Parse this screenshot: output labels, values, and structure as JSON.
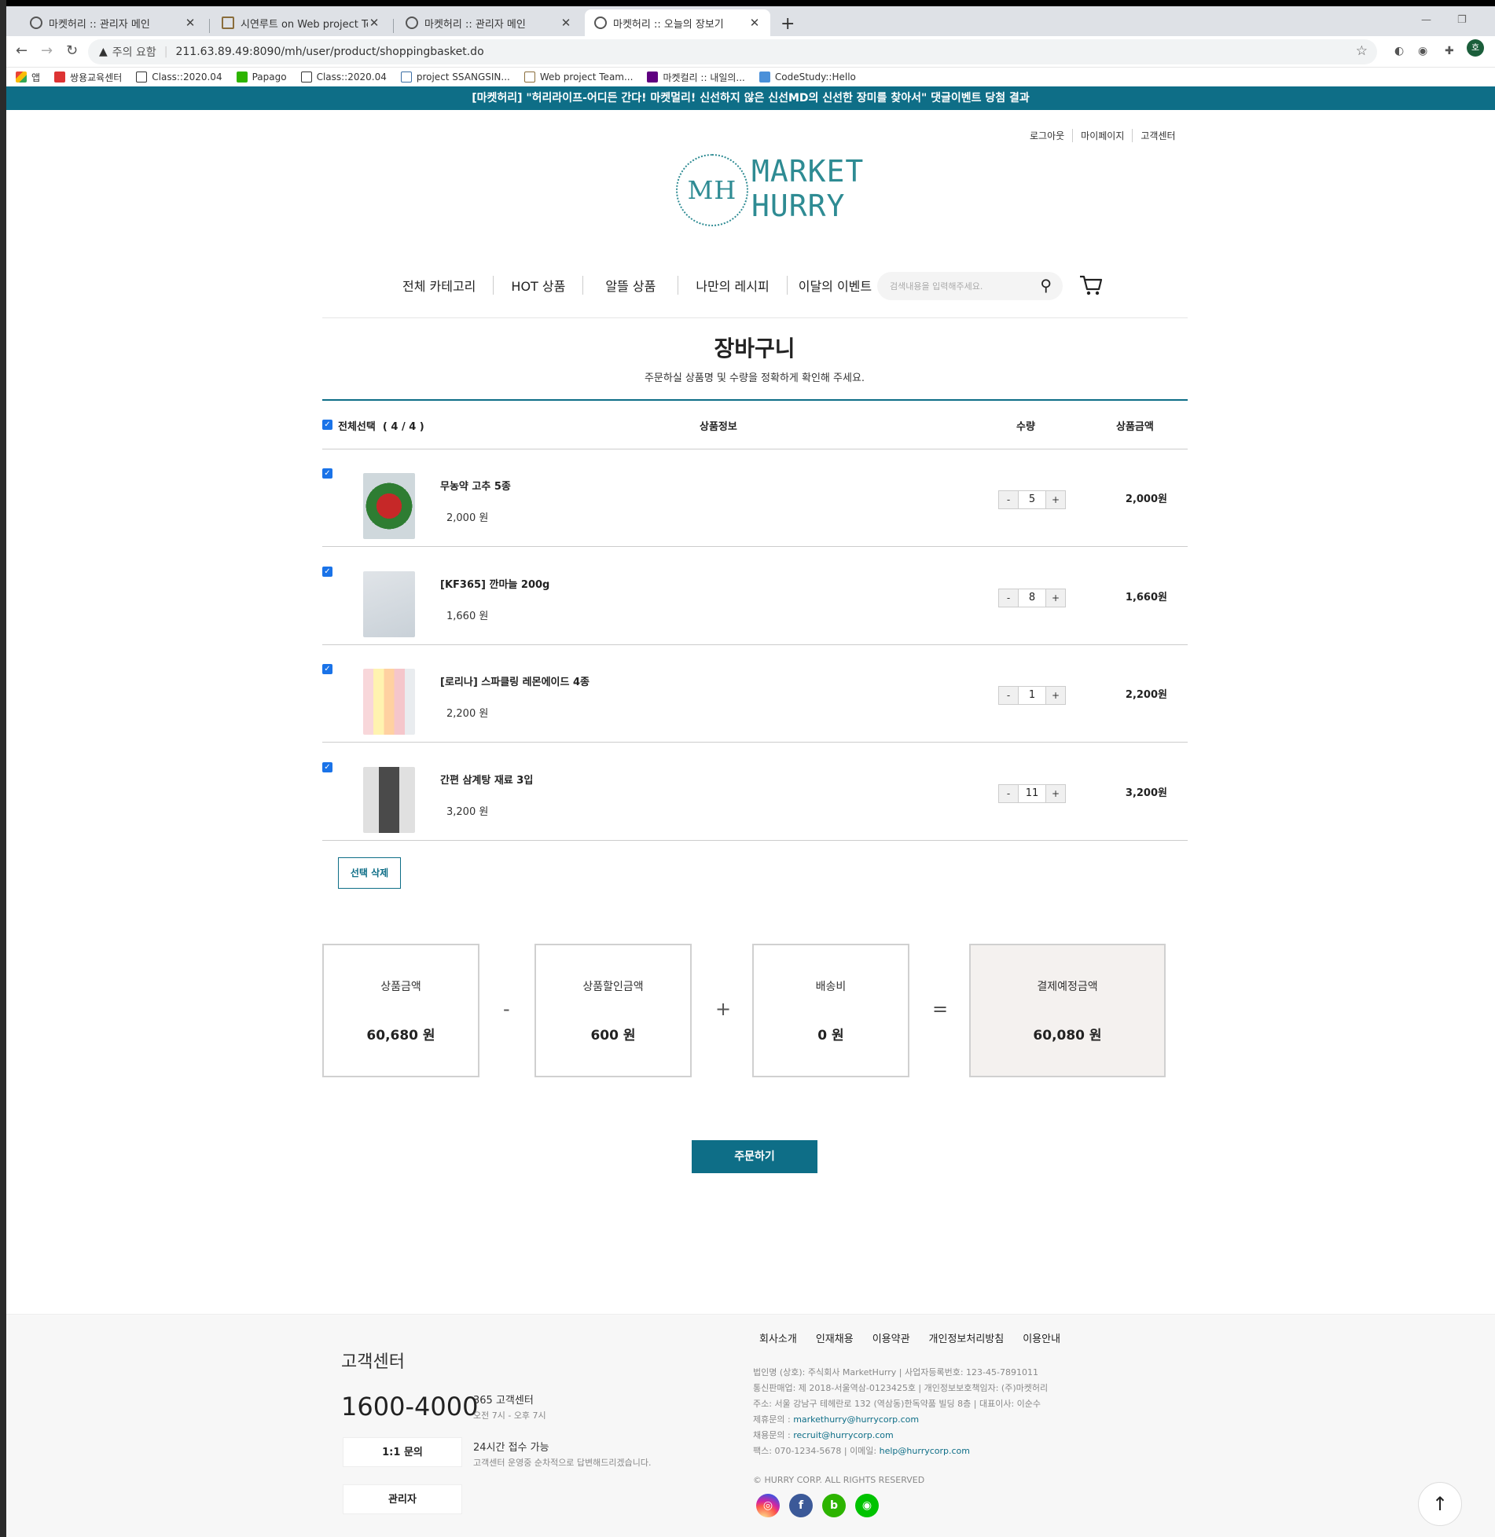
{
  "browser": {
    "tabs": [
      {
        "title": "마켓허리 :: 관리자 메인",
        "active": false
      },
      {
        "title": "시연루트 on Web project Team",
        "active": false
      },
      {
        "title": "마켓허리 :: 관리자 메인",
        "active": false
      },
      {
        "title": "마켓허리 :: 오늘의 장보기",
        "active": true
      }
    ],
    "new_tab": "+",
    "security_label": "주의 요함",
    "url": "211.63.89.49:8090/mh/user/product/shoppingbasket.do",
    "profile_initial": "호",
    "bookmarks": [
      "앱",
      "쌍용교육센터",
      "Class::2020.04",
      "Papago",
      "Class::2020.04",
      "project SSANGSIN...",
      "Web project Team...",
      "마켓컬리 :: 내일의...",
      "CodeStudy::Hello"
    ]
  },
  "banner": "[마켓허리] \"허리라이프-어디든 간다! 마켓멀리! 신선하지 않은 신선MD의 신선한 장미를 찾아서\" 댓글이벤트 당첨 결과",
  "header": {
    "links": [
      "로그아웃",
      "마이페이지",
      "고객센터"
    ],
    "logo": {
      "mark": "MH",
      "line1": "MARKET",
      "line2": "HURRY"
    },
    "menu": [
      "전체 카테고리",
      "HOT 상품",
      "알뜰 상품",
      "나만의 레시피",
      "이달의 이벤트"
    ],
    "search_placeholder": "검색내용을 입력해주세요."
  },
  "page": {
    "title": "장바구니",
    "subtitle": "주문하실 상품명 및 수량을 정확하게 확인해 주세요."
  },
  "cart": {
    "select_all_label": "전체선택",
    "select_count": "( 4 / 4 )",
    "headers": {
      "info": "상품정보",
      "qty": "수량",
      "price": "상품금액"
    },
    "items": [
      {
        "name": "무농약 고추 5종",
        "price": "2,000 원",
        "qty": "5",
        "total": "2,000원"
      },
      {
        "name": "[KF365] 깐마늘 200g",
        "price": "1,660 원",
        "qty": "8",
        "total": "1,660원"
      },
      {
        "name": "[로리나] 스파클링 레몬에이드 4종",
        "price": "2,200 원",
        "qty": "1",
        "total": "2,200원"
      },
      {
        "name": "간편 삼계탕 재료 3입",
        "price": "3,200 원",
        "qty": "11",
        "total": "3,200원"
      }
    ],
    "minus": "-",
    "plus": "+",
    "delete_selected": "선택 삭제"
  },
  "summary": {
    "product_amount": {
      "label": "상품금액",
      "value": "60,680 원"
    },
    "discount": {
      "label": "상품할인금액",
      "value": "600 원"
    },
    "shipping": {
      "label": "배송비",
      "value": "0 원"
    },
    "final": {
      "label": "결제예정금액",
      "value": "60,080 원"
    },
    "ops": [
      "-",
      "+",
      "="
    ]
  },
  "order_button": "주문하기",
  "footer": {
    "cs_title": "고객센터",
    "phone": "1600-4000",
    "cs_365": "365 고객센터",
    "cs_hours": "오전 7시 - 오후 7시",
    "inquiry_btn": "1:1 문의",
    "inquiry_24": "24시간 접수 가능",
    "inquiry_desc": "고객센터 운영중 순차적으로 답변해드리겠습니다.",
    "admin_btn": "관리자",
    "links": [
      "회사소개",
      "인재채용",
      "이용약관",
      "개인정보처리방침",
      "이용안내"
    ],
    "info_lines": [
      "법인명 (상호): 주식회사 MarketHurry | 사업자등록번호: 123-45-7891011",
      "통신판매업: 제 2018-서울역삼-0123425호 | 개인정보보호책임자: (주)마켓허리",
      "주소: 서울 강남구 테헤란로 132 (역삼동)한독약품 빌딩 8층 | 대표이사: 이순수"
    ],
    "partner_label": "제휴문의 : ",
    "partner_email": "markethurry@hurrycorp.com",
    "recruit_label": "채용문의 : ",
    "recruit_email": "recruit@hurrycorp.com",
    "fax_label": "팩스: 070-1234-5678 | 이메일: ",
    "help_email": "help@hurrycorp.com",
    "copyright": "© HURRY CORP. ALL RIGHTS RESERVED",
    "sns": [
      "instagram",
      "facebook",
      "blog",
      "line"
    ]
  }
}
